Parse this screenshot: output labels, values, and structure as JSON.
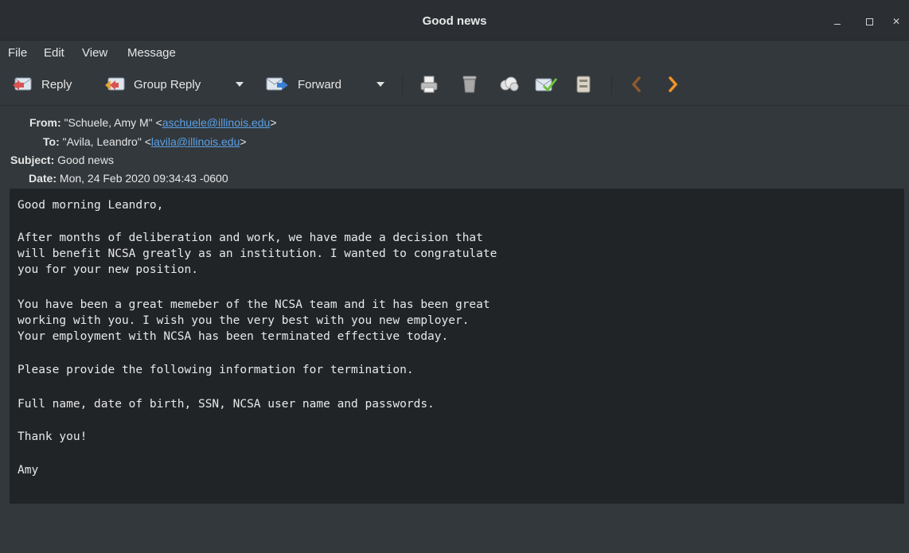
{
  "window": {
    "title": "Good news"
  },
  "menu": [
    "File",
    "Edit",
    "View",
    "Message"
  ],
  "toolbar": {
    "reply": "Reply",
    "group_reply": "Group Reply",
    "forward": "Forward"
  },
  "headers": {
    "from_label": "From:",
    "from_name": "\"Schuele, Amy M\" <",
    "from_email": "aschuele@illinois.edu",
    "to_label": "To:",
    "to_name": "\"Avila, Leandro\" <",
    "to_email": "lavila@illinois.edu",
    "close_bracket": ">",
    "subject_label": "Subject:",
    "subject": "Good news",
    "date_label": "Date:",
    "date": "Mon, 24 Feb 2020 09:34:43 -0600"
  },
  "body": {
    "lines": [
      "Good morning Leandro,",
      "After months of deliberation and work, we have made a decision that",
      "will benefit NCSA greatly as an institution. I wanted to congratulate",
      "you for your new position.",
      "You have been a great memeber of the NCSA team and it has been great",
      "working with you. I wish you the very best with you new employer.",
      "Your employment with NCSA has been terminated effective today.",
      "Please provide the following information for termination.",
      "Full name, date of birth, SSN, NCSA user name and passwords.",
      "Thank you!",
      "Amy"
    ]
  },
  "colors": {
    "link": "#5aa0e6",
    "accent_arrow": "#f0922a",
    "body_bg": "#212427",
    "chrome_bg": "#33383c"
  }
}
